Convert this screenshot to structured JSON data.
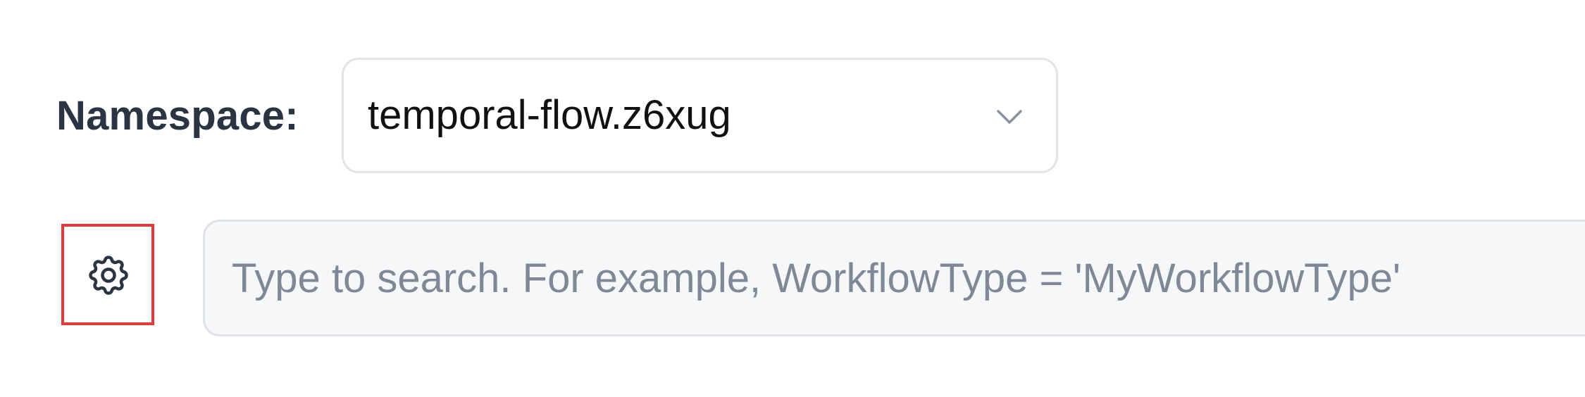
{
  "namespace": {
    "label": "Namespace:",
    "selected": "temporal-flow.z6xug",
    "icon": "chevron-down-icon"
  },
  "settings": {
    "icon": "gear-icon",
    "highlight_color": "#e5393a"
  },
  "search": {
    "placeholder": "Type to search. For example, WorkflowType = 'MyWorkflowType'",
    "value": ""
  }
}
